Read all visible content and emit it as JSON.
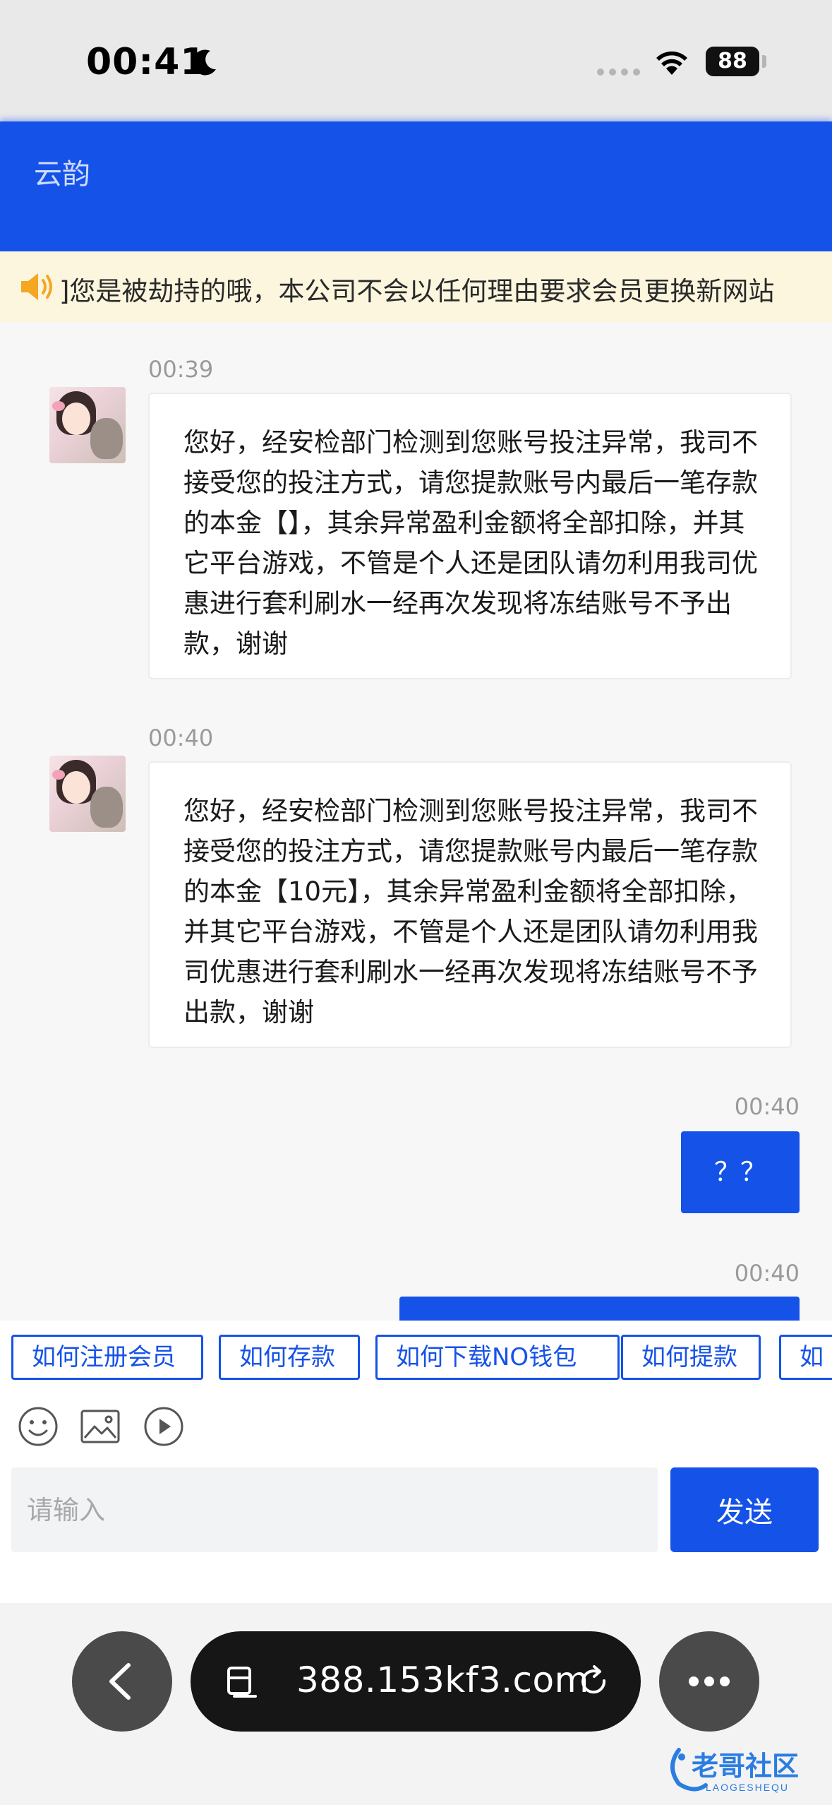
{
  "status_bar": {
    "time": "00:41",
    "battery": "88"
  },
  "header": {
    "title": "云韵"
  },
  "notice": {
    "text": "]您是被劫持的哦，本公司不会以任何理由要求会员更换新网站"
  },
  "messages": [
    {
      "time": "00:39",
      "text": "您好，经安检部门检测到您账号投注异常，我司不接受您的投注方式，请您提款账号内最后一笔存款的本金【】，其余异常盈利金额将全部扣除，并其它平台游戏，不管是个人还是团队请勿利用我司优惠进行套利刷水一经再次发现将冻结账号不予出款，谢谢"
    },
    {
      "time": "00:40",
      "text": "您好，经安检部门检测到您账号投注异常，我司不接受您的投注方式，请您提款账号内最后一笔存款的本金【10元】，其余异常盈利金额将全部扣除，并其它平台游戏，不管是个人还是团队请勿利用我司优惠进行套利刷水一经再次发现将冻结账号不予出款，谢谢"
    },
    {
      "time": "00:40",
      "text": "？？"
    },
    {
      "time": "00:40",
      "text": ""
    }
  ],
  "quick_replies": [
    "如何注册会员",
    "如何存款",
    "如何下载NO钱包",
    "如何提款",
    "如"
  ],
  "icons": [
    "emoji-icon",
    "image-icon",
    "video-icon"
  ],
  "composer": {
    "placeholder": "请输入",
    "send_label": "发送"
  },
  "browser": {
    "url": "388.153kf3.com"
  },
  "watermark": {
    "text": "老哥社区",
    "subtext": "LAOGESHEQU"
  },
  "colors": {
    "accent": "#1552e8",
    "notice_bg": "#fdf6de"
  }
}
